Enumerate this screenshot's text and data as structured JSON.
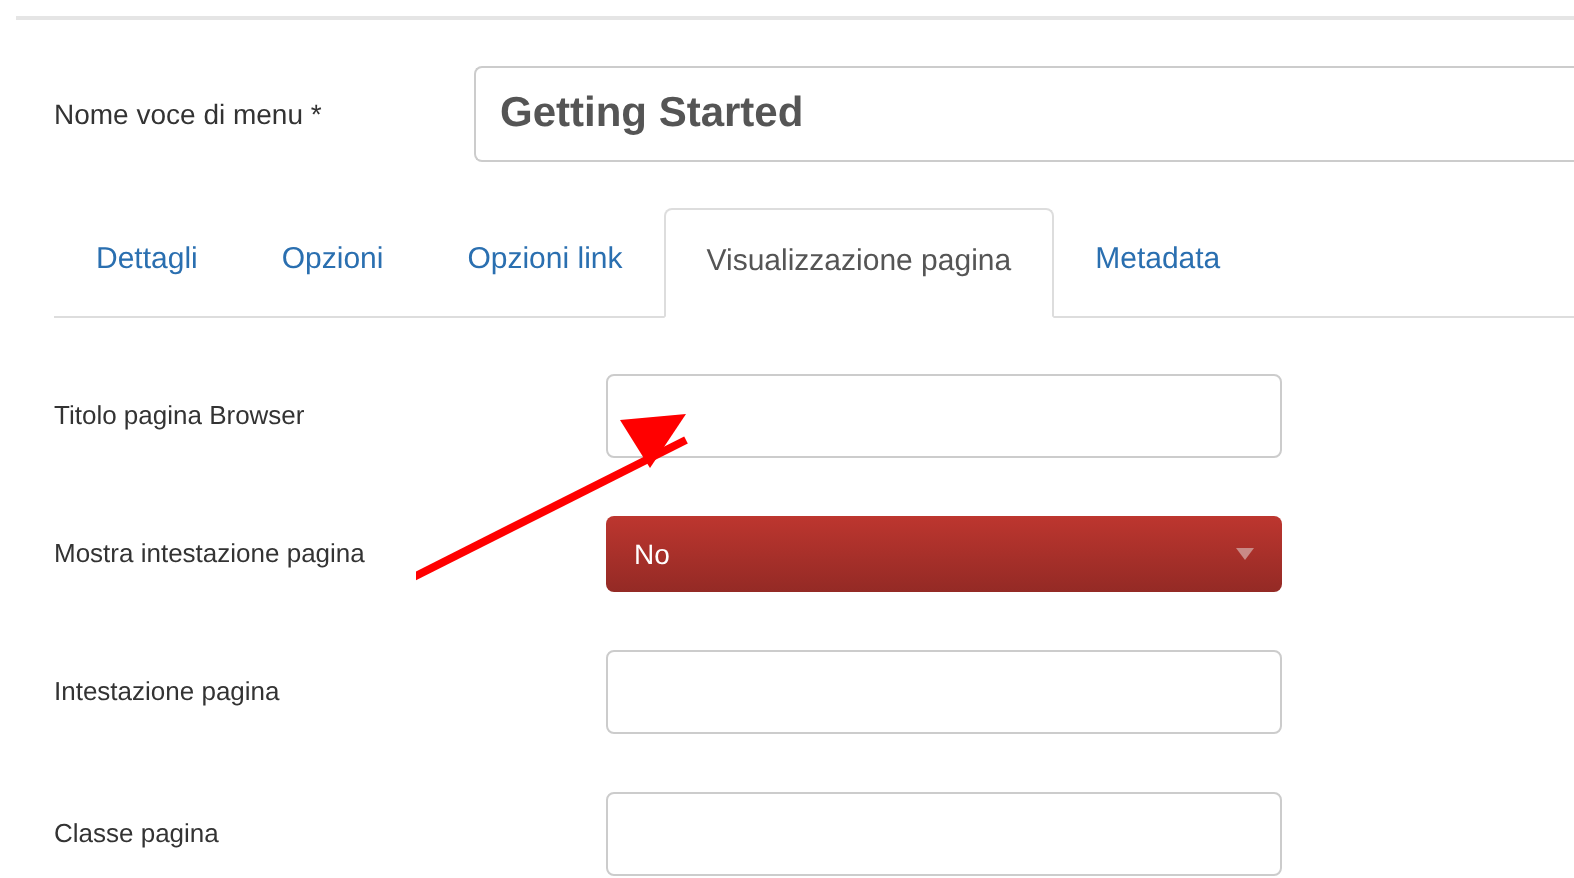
{
  "menu_item_name": {
    "label": "Nome voce di menu *",
    "value": "Getting Started"
  },
  "tabs": [
    {
      "label": "Dettagli",
      "selected": false
    },
    {
      "label": "Opzioni",
      "selected": false
    },
    {
      "label": "Opzioni link",
      "selected": false
    },
    {
      "label": "Visualizzazione pagina",
      "selected": true
    },
    {
      "label": "Metadata",
      "selected": false
    }
  ],
  "fields": [
    {
      "kind": "text",
      "label": "Titolo pagina Browser"
    },
    {
      "kind": "select",
      "label": "Mostra intestazione pagina",
      "value": "No"
    },
    {
      "kind": "text",
      "label": "Intestazione pagina"
    },
    {
      "kind": "text",
      "label": "Classe pagina"
    }
  ]
}
